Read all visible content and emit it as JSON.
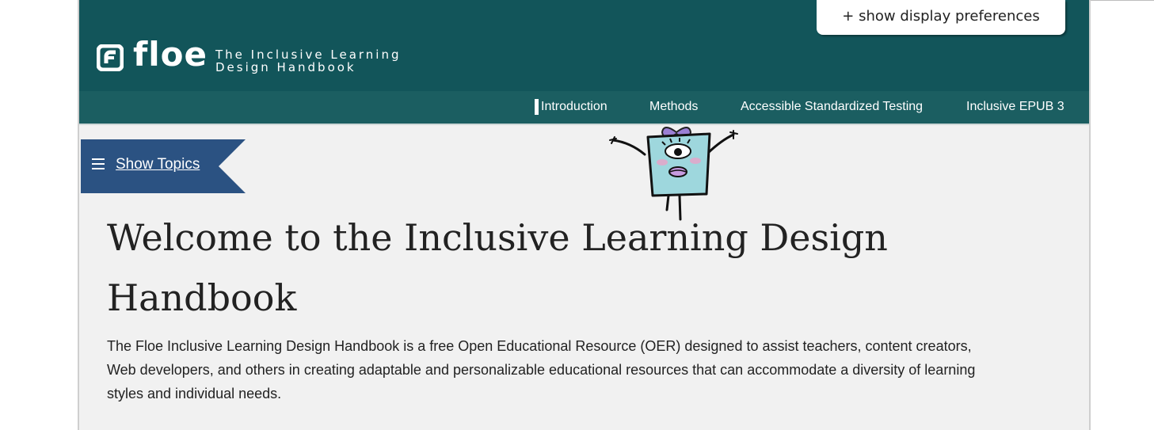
{
  "header": {
    "brand": "floe",
    "tagline_line1": "The Inclusive Learning",
    "tagline_line2": "Design Handbook",
    "preferences_button": "+ show display preferences",
    "colors": {
      "header_bg": "#12555a",
      "nav_bg": "#1b5e61"
    }
  },
  "nav": {
    "items": [
      {
        "label": "Introduction",
        "active": true
      },
      {
        "label": "Methods"
      },
      {
        "label": "Accessible Standardized Testing"
      },
      {
        "label": "Inclusive EPUB 3"
      }
    ]
  },
  "sidebar_toggle": {
    "label": "Show Topics",
    "icon": "hamburger-menu-icon",
    "color": "#2b5282"
  },
  "mascot": {
    "icon": "floe-mascot-illustration"
  },
  "main": {
    "title": "Welcome to the Inclusive Learning Design Handbook",
    "intro": "The Floe Inclusive Learning Design Handbook is a free Open Educational Resource (OER) designed to assist teachers, content creators, Web developers, and others in creating adaptable and personalizable educational resources that can accommodate a diversity of learning styles and individual needs."
  }
}
